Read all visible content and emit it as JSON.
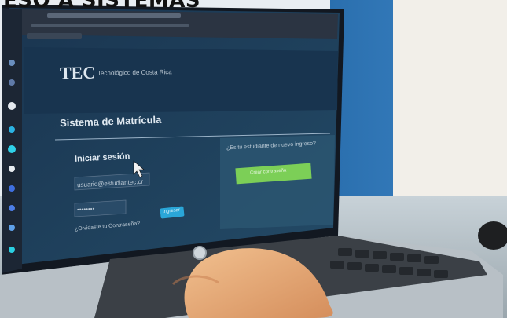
{
  "banner": {
    "text": "ESO A SISTEMAS"
  },
  "screen": {
    "logo_text": "TEC",
    "logo_subtitle": "Tecnológico de Costa Rica",
    "header_title": "Sistema de Matrícula",
    "login_heading": "Iniciar sesión",
    "email_field_value": "usuario@estudiantec.cr",
    "password_field_value": "••••••••",
    "forgot_link": "¿Olvidaste tu Contraseña?",
    "login_button_label": "Ingresar",
    "new_student_question": "¿Es tu estudiante de nuevo ingreso?",
    "new_student_button_label": "Crear contraseña"
  },
  "colors": {
    "screen_bg": "#1f3f57",
    "login_button": "#2aa6d8",
    "green_button": "#7ccf57"
  }
}
